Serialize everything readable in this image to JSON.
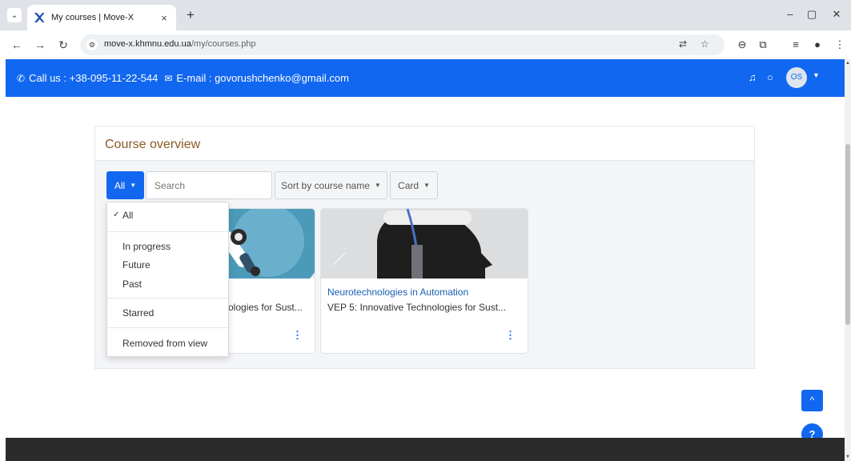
{
  "browser": {
    "tab_title": "My courses | Move-X",
    "tab_close": "×",
    "new_tab": "+",
    "url_host": "move-x.khmnu.edu.ua",
    "url_path": "/my/courses.php",
    "window_controls": [
      "–",
      "▢",
      "✕"
    ]
  },
  "header": {
    "phone_label": "Call us : +38-095-11-22-544",
    "email_label": "E-mail : govorushchenko@gmail.com",
    "avatar_initials": "OS",
    "bg_color": "#1167f0"
  },
  "block": {
    "title": "Course overview"
  },
  "filters": {
    "grouping_label": "All",
    "search_placeholder": "Search",
    "sort_label": "Sort by course name",
    "view_label": "Card"
  },
  "dropdown": {
    "items": [
      {
        "label": "All",
        "selected": true
      },
      {
        "label": "In progress"
      },
      {
        "label": "Future"
      },
      {
        "label": "Past"
      },
      {
        "label": "Starred"
      },
      {
        "label": "Removed from view"
      }
    ]
  },
  "courses": [
    {
      "category": "",
      "name_visible": "ologies for Sust...",
      "menu": "⋮"
    },
    {
      "category": "Neurotechnologies in Automation",
      "name_visible": "VEP 5: Innovative Technologies for Sust...",
      "menu": "⋮"
    }
  ],
  "floating": {
    "back_to_top": "^",
    "help": "?"
  }
}
